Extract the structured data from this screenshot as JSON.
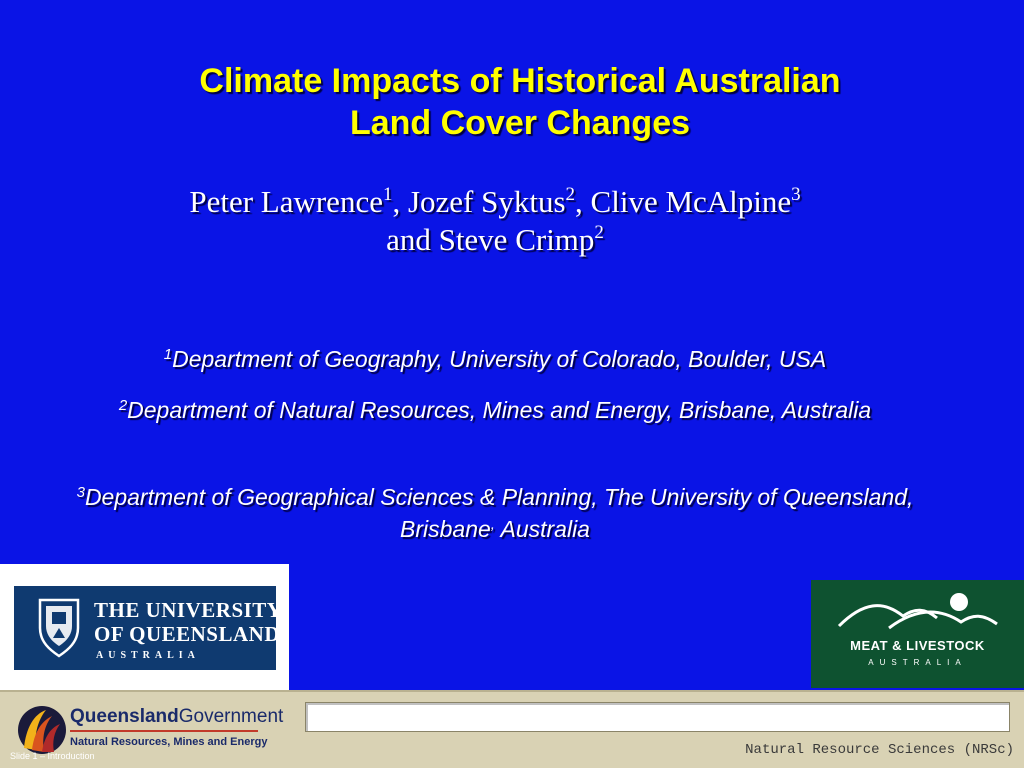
{
  "title": {
    "line1": "Climate Impacts of Historical Australian",
    "line2": "Land Cover Changes"
  },
  "authors": {
    "a1": "Peter Lawrence",
    "a1_sup": "1",
    "a2": ", Jozef Syktus",
    "a2_sup": "2",
    "a3": ", Clive McAlpine",
    "a3_sup": "3",
    "a4": "and Steve Crimp",
    "a4_sup": "2"
  },
  "affiliations": [
    {
      "sup": "1",
      "text": "Department of Geography, University of Colorado, Boulder, USA"
    },
    {
      "sup": "2",
      "text": "Department of Natural Resources, Mines and Energy, Brisbane, Australia"
    },
    {
      "sup": "3",
      "text1": "Department of Geographical Sciences & Planning, The University of Queensland, Brisbane",
      "comma": ",",
      "text2": " Australia"
    }
  ],
  "logos": {
    "uq": {
      "line1": "THE UNIVERSITY",
      "line2": "OF QUEENSLAND",
      "line3": "AUSTRALIA",
      "color": "#0f3a70"
    },
    "mla": {
      "name": "MEAT & LIVESTOCK",
      "sub": "AUSTRALIA",
      "color": "#0e5230"
    },
    "qg": {
      "name_bold": "Queensland",
      "name_light": "Government",
      "dept": "Natural Resources, Mines and Energy"
    }
  },
  "footer": {
    "slide_label": "Slide 1 – Introduction",
    "note": "Natural Resource Sciences (NRSc)"
  },
  "colors": {
    "background": "#0a14e6",
    "title": "#ffff00",
    "text": "#ffffff",
    "footer": "#d9d2b4"
  }
}
